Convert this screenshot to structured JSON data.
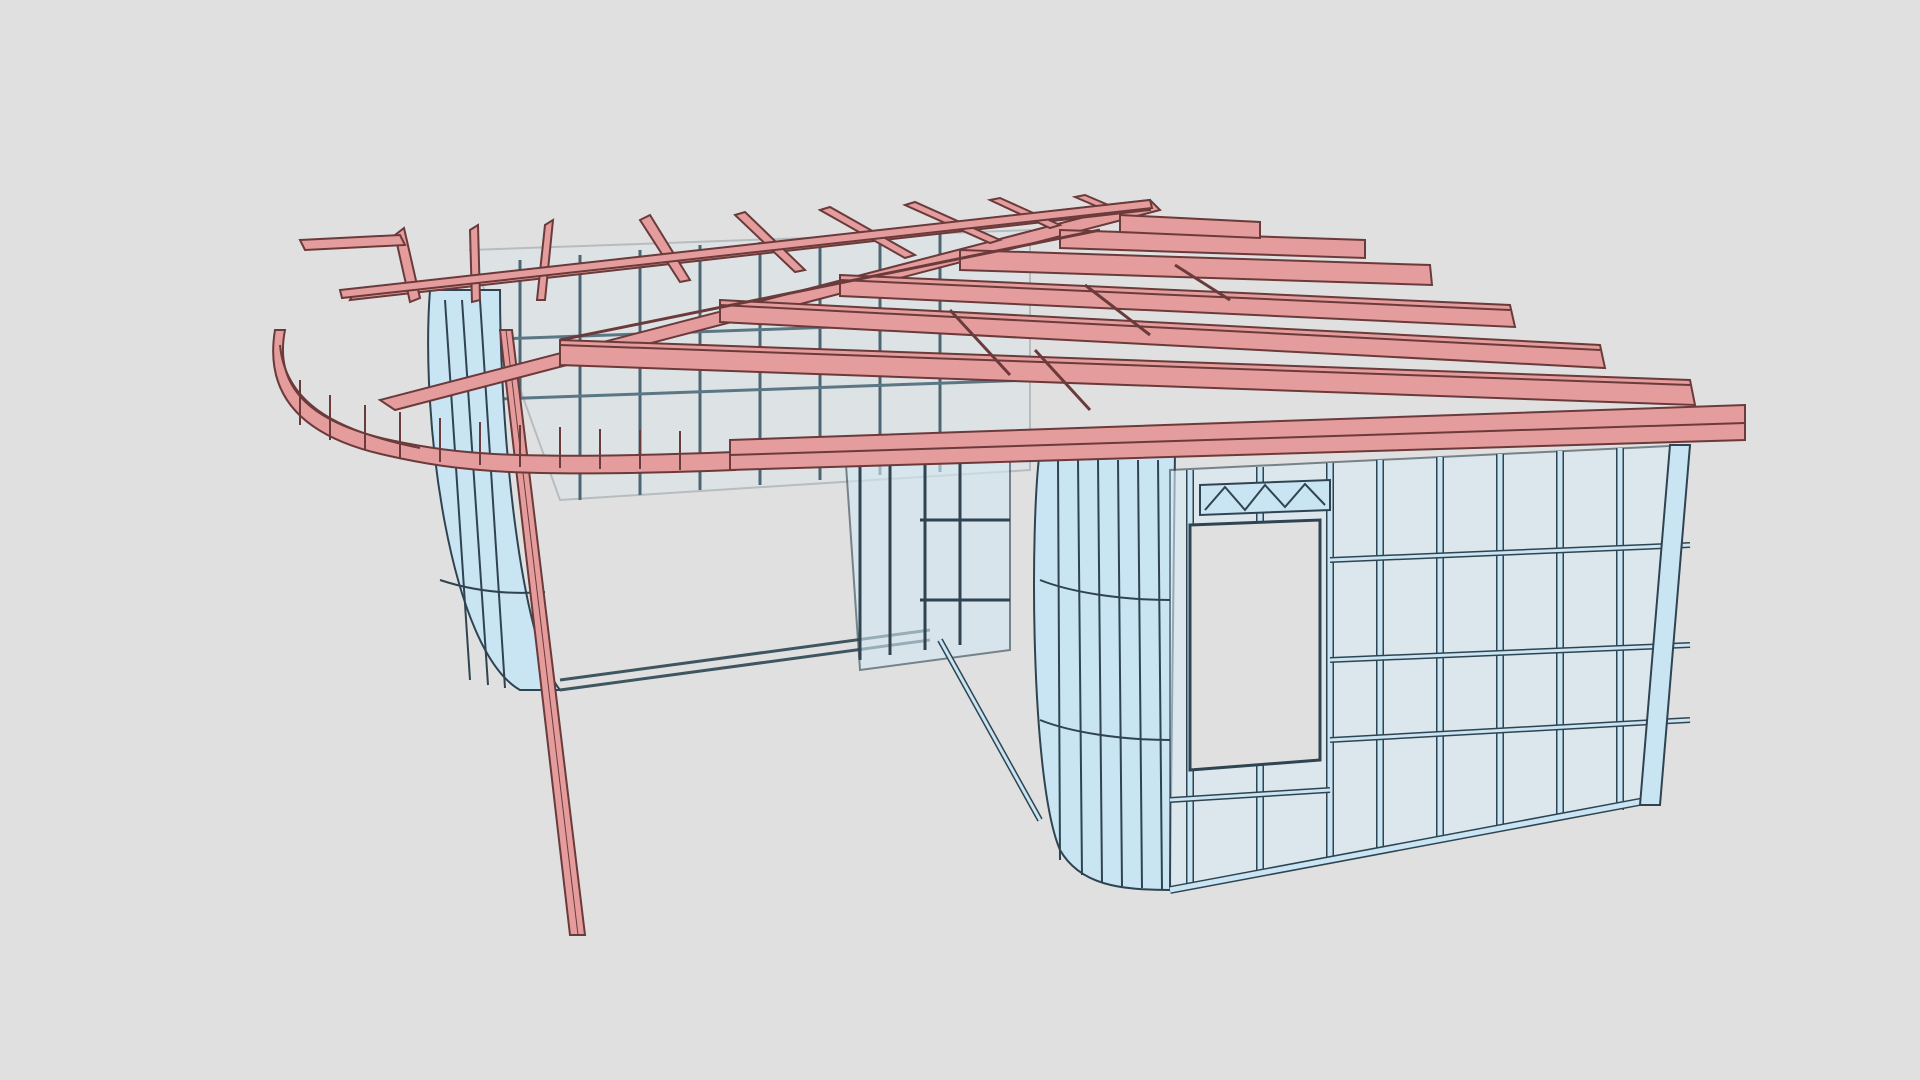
{
  "viewport": {
    "background_color": "#e0e0e0",
    "roof_color": "#e59c9c",
    "roof_stroke": "#6b3a3a",
    "wall_color": "#c9e4f3",
    "wall_stroke": "#3f5561"
  }
}
